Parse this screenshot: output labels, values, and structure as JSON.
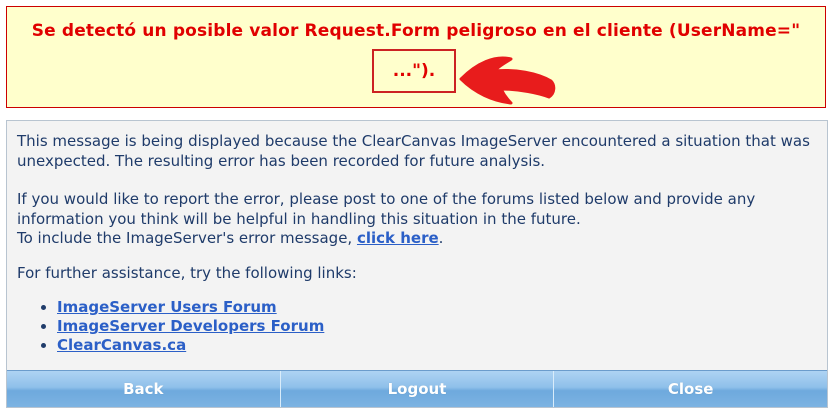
{
  "error": {
    "line1": "Se detectó un posible valor Request.Form peligroso en el cliente (UserName=\"",
    "line2": "...\")."
  },
  "message": {
    "para1": "This message is being displayed because the ClearCanvas ImageServer encountered a situation that was unexpected. The resulting error has been recorded for future analysis.",
    "para2": "If you would like to report the error, please post to one of the forums listed below and provide any information you think will be helpful in handling this situation in the future.",
    "para2b_prefix": "To include the ImageServer's error message, ",
    "para2b_link": "click here",
    "para2b_suffix": ".",
    "para3": "For further assistance, try the following links:",
    "links": [
      "ImageServer Users Forum",
      "ImageServer Developers Forum",
      "ClearCanvas.ca"
    ]
  },
  "buttons": {
    "back": "Back",
    "logout": "Logout",
    "close": "Close"
  },
  "colors": {
    "error_text": "#e00000",
    "banner_bg": "#ffffcc",
    "link": "#2b5fc7",
    "body_text": "#1f3b6a"
  }
}
